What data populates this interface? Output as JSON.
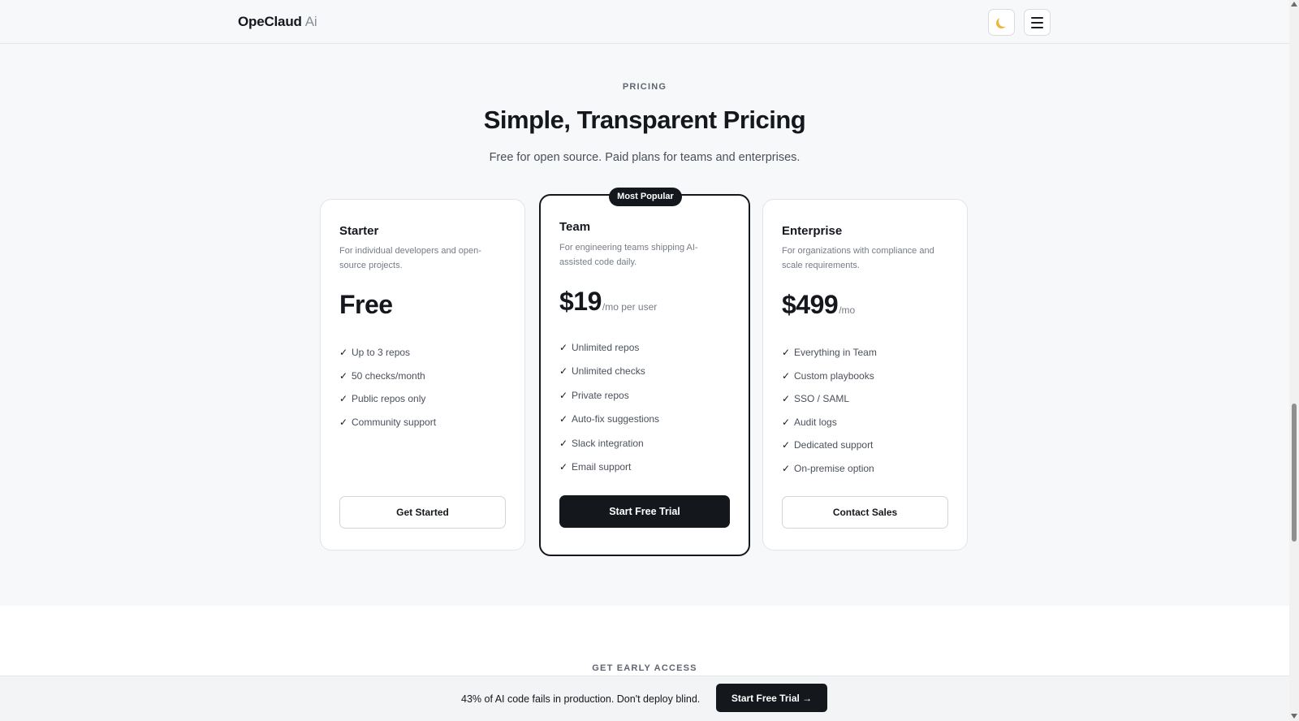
{
  "header": {
    "brand": "OpeClaud",
    "brand_suffix": "Ai",
    "theme_icon": "moon-icon",
    "menu_icon": "hamburger-menu-icon"
  },
  "pricing": {
    "eyebrow": "PRICING",
    "title": "Simple, Transparent Pricing",
    "subtitle": "Free for open source. Paid plans for teams and enterprises.",
    "plans": [
      {
        "name": "Starter",
        "description": "For individual developers and open-source projects.",
        "price": "Free",
        "period": "",
        "features": [
          "Up to 3 repos",
          "50 checks/month",
          "Public repos only",
          "Community support"
        ],
        "cta": "Get Started"
      },
      {
        "name": "Team",
        "badge": "Most Popular",
        "description": "For engineering teams shipping AI-assisted code daily.",
        "price": "$19",
        "period": "/mo per user",
        "features": [
          "Unlimited repos",
          "Unlimited checks",
          "Private repos",
          "Auto-fix suggestions",
          "Slack integration",
          "Email support"
        ],
        "cta": "Start Free Trial"
      },
      {
        "name": "Enterprise",
        "description": "For organizations with compliance and scale requirements.",
        "price": "$499",
        "period": "/mo",
        "features": [
          "Everything in Team",
          "Custom playbooks",
          "SSO / SAML",
          "Audit logs",
          "Dedicated support",
          "On-premise option"
        ],
        "cta": "Contact Sales"
      }
    ],
    "check_glyph": "✓"
  },
  "early_access": {
    "eyebrow": "GET EARLY ACCESS"
  },
  "sticky_bar": {
    "text": "43% of AI code fails in production. Don't deploy blind.",
    "button": "Start Free Trial →"
  },
  "colors": {
    "accent": "#14171c",
    "background": "#f7f8fa",
    "card": "#ffffff",
    "muted_text": "#767c86"
  }
}
